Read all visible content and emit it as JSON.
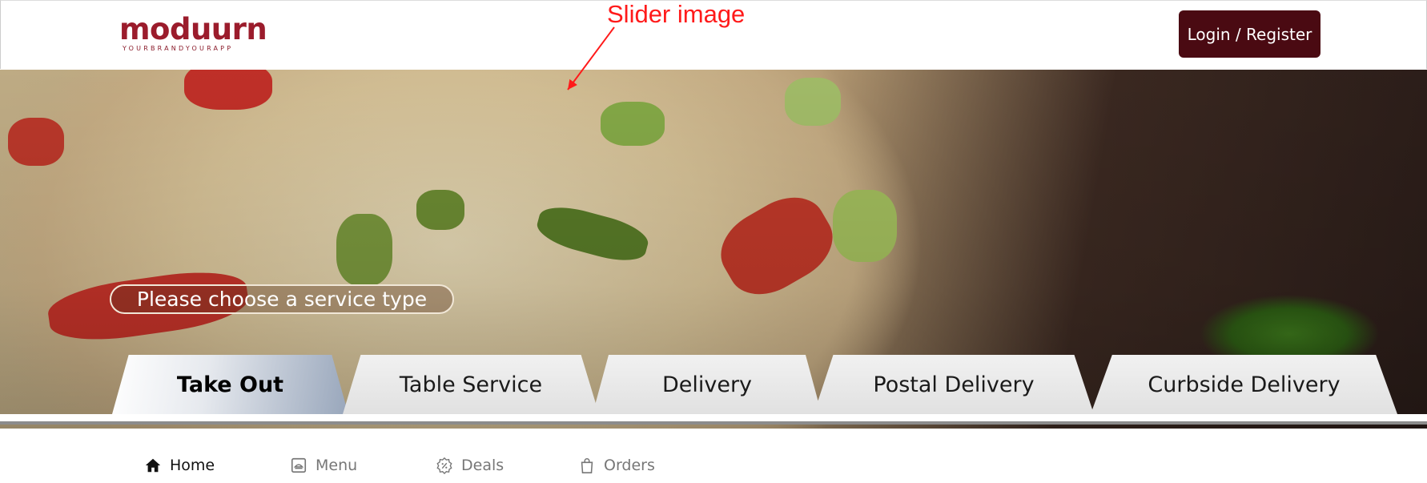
{
  "annotation": {
    "text": "Slider image"
  },
  "brand": {
    "name": "moduurn",
    "tagline": "YOURBRANDYOURAPP",
    "color": "#9b1c2c"
  },
  "header": {
    "login_label": "Login / Register",
    "login_color": "#4a0a12"
  },
  "slider": {
    "prompt": "Please choose a service type"
  },
  "service_tabs": [
    {
      "label": "Take Out",
      "active": true
    },
    {
      "label": "Table Service",
      "active": false
    },
    {
      "label": "Delivery",
      "active": false
    },
    {
      "label": "Postal Delivery",
      "active": false
    },
    {
      "label": "Curbside Delivery",
      "active": false
    }
  ],
  "nav": [
    {
      "label": "Home",
      "icon": "home-icon",
      "active": true
    },
    {
      "label": "Menu",
      "icon": "menu-icon",
      "active": false
    },
    {
      "label": "Deals",
      "icon": "deals-icon",
      "active": false
    },
    {
      "label": "Orders",
      "icon": "orders-icon",
      "active": false
    }
  ]
}
